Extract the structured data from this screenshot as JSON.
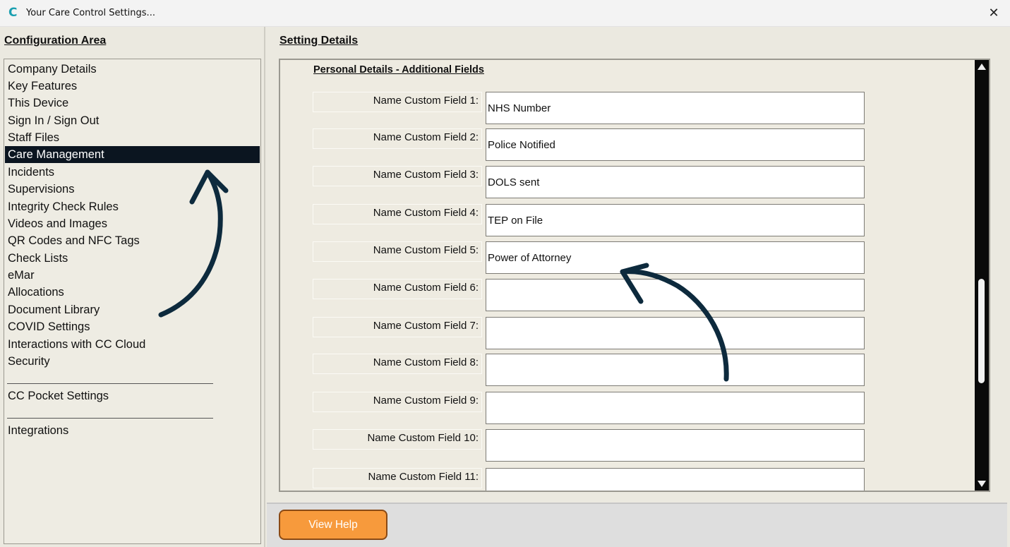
{
  "window": {
    "title": "Your Care Control Settings...",
    "app_icon_glyph": "C",
    "close_glyph": "✕"
  },
  "left_pane": {
    "heading": "Configuration Area",
    "items": [
      {
        "label": "Company Details"
      },
      {
        "label": "Key Features"
      },
      {
        "label": "This Device"
      },
      {
        "label": "Sign In / Sign Out"
      },
      {
        "label": "Staff Files"
      },
      {
        "label": "Care Management",
        "selected": true
      },
      {
        "label": "Incidents"
      },
      {
        "label": "Supervisions"
      },
      {
        "label": "Integrity Check Rules"
      },
      {
        "label": "Videos and Images"
      },
      {
        "label": "QR Codes and NFC Tags"
      },
      {
        "label": "Check Lists"
      },
      {
        "label": "eMar"
      },
      {
        "label": "Allocations"
      },
      {
        "label": "Document Library"
      },
      {
        "label": "COVID Settings"
      },
      {
        "label": "Interactions with CC Cloud"
      },
      {
        "label": "Security"
      }
    ],
    "extra_items": [
      {
        "label": "CC Pocket Settings"
      },
      {
        "label": "Integrations"
      }
    ]
  },
  "right_pane": {
    "heading": "Setting Details",
    "section_title": "Personal Details - Additional Fields",
    "fields": [
      {
        "label": "Name Custom Field 1:",
        "value": "NHS Number"
      },
      {
        "label": "Name Custom Field 2:",
        "value": "Police Notified"
      },
      {
        "label": "Name Custom Field 3:",
        "value": "DOLS sent"
      },
      {
        "label": "Name Custom Field 4:",
        "value": "TEP on File"
      },
      {
        "label": "Name Custom Field 5:",
        "value": "Power of Attorney"
      },
      {
        "label": "Name Custom Field 6:",
        "value": ""
      },
      {
        "label": "Name Custom Field 7:",
        "value": ""
      },
      {
        "label": "Name Custom Field 8:",
        "value": ""
      },
      {
        "label": "Name Custom Field 9:",
        "value": ""
      },
      {
        "label": "Name Custom Field 10:",
        "value": ""
      },
      {
        "label": "Name Custom Field 11:",
        "value": ""
      }
    ]
  },
  "footer": {
    "help_button": "View Help"
  },
  "colors": {
    "selected_bg": "#0b1520",
    "help_button": "#f79a3c",
    "annotation_arrow": "#0d2a3d",
    "scrollbar": "#0a0a0a"
  }
}
